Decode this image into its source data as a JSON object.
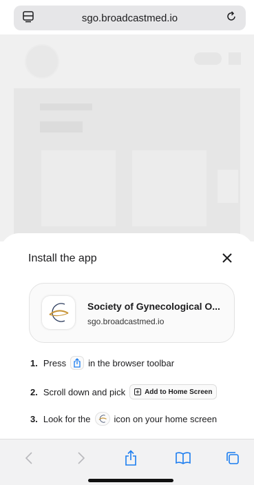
{
  "browser": {
    "url": "sgo.broadcastmed.io",
    "menu_icon": "tab-menu-icon",
    "reload_icon": "reload-icon"
  },
  "sheet": {
    "title": "Install the app",
    "close_icon": "close-icon",
    "app": {
      "name": "Society of Gynecological O...",
      "domain": "sgo.broadcastmed.io",
      "icon": "sgo-logo"
    },
    "steps": [
      {
        "num": "1.",
        "before": "Press",
        "after": "in the browser toolbar",
        "icon": "share-icon"
      },
      {
        "num": "2.",
        "before": "Scroll down and pick",
        "chip": "Add to Home Screen",
        "icon": "add-square-icon"
      },
      {
        "num": "3.",
        "before": "Look for the",
        "after": "icon on your home screen",
        "icon": "sgo-logo"
      }
    ]
  },
  "toolbar": {
    "items": [
      "back-icon",
      "forward-icon",
      "share-icon",
      "bookmarks-icon",
      "tabs-icon"
    ]
  },
  "colors": {
    "accent": "#1a7cf0",
    "sheet_bg": "#ffffff",
    "toolbar_bg": "#f2f2f3"
  }
}
